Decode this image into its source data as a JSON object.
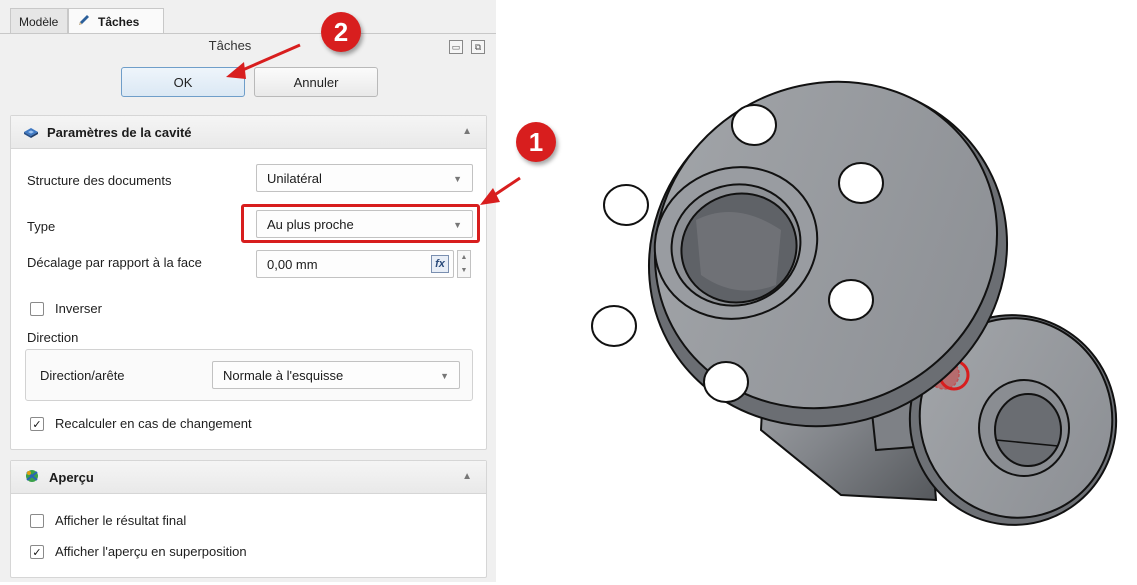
{
  "tabs": {
    "model": "Modèle",
    "tasks": "Tâches"
  },
  "task_panel": {
    "title": "Tâches",
    "ok_label": "OK",
    "cancel_label": "Annuler"
  },
  "cavity": {
    "header": "Paramètres de la cavité",
    "structure_label": "Structure des documents",
    "structure_value": "Unilatéral",
    "type_label": "Type",
    "type_value": "Au plus proche",
    "offset_label": "Décalage par rapport à la face",
    "offset_value": "0,00 mm",
    "fx_label": "fx",
    "reverse_label": "Inverser",
    "direction_group": "Direction",
    "direction_label": "Direction/arête",
    "direction_value": "Normale à l'esquisse",
    "recompute_label": "Recalculer en cas de changement"
  },
  "preview": {
    "header": "Aperçu",
    "show_final_label": "Afficher le résultat final",
    "show_overlay_label": "Afficher l'aperçu en superposition"
  },
  "annotations": {
    "badge1": "1",
    "badge2": "2"
  },
  "colors": {
    "highlight_red": "#d81e1e",
    "ok_blue": "#6f9ec9",
    "part_gray": "#8f9297"
  }
}
